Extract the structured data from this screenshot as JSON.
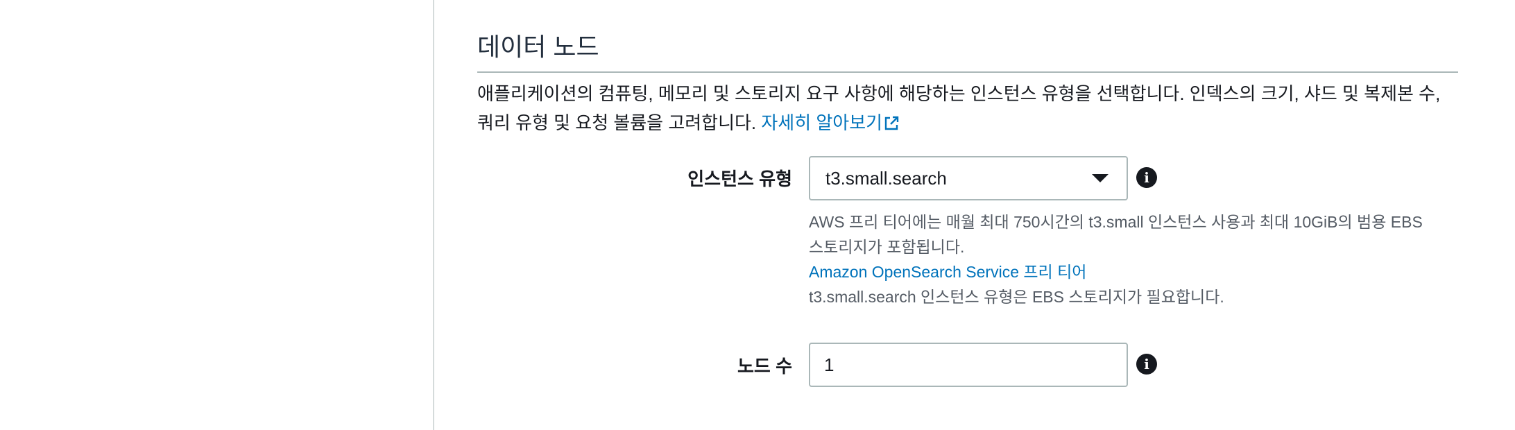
{
  "section": {
    "title": "데이터 노드",
    "description": "애플리케이션의 컴퓨팅, 메모리 및 스토리지 요구 사항에 해당하는 인스턴스 유형을 선택합니다. 인덱스의 크기, 샤드 및 복제본 수, 쿼리 유형 및 요청 볼륨을 고려합니다.",
    "learn_more": "자세히 알아보기"
  },
  "instance_type": {
    "label": "인스턴스 유형",
    "value": "t3.small.search",
    "help_line1": "AWS 프리 티어에는 매월 최대 750시간의 t3.small 인스턴스 사용과 최대 10GiB의 범용 EBS",
    "help_line2": "스토리지가 포함됩니다.",
    "help_link": "Amazon OpenSearch Service 프리 티어",
    "help_line3": "t3.small.search 인스턴스 유형은 EBS 스토리지가 필요합니다."
  },
  "node_count": {
    "label": "노드 수",
    "value": "1"
  },
  "icons": {
    "info": "i"
  },
  "colors": {
    "link": "#0073bb",
    "border": "#aab7b8",
    "text": "#16191f",
    "help_text": "#545b64"
  }
}
